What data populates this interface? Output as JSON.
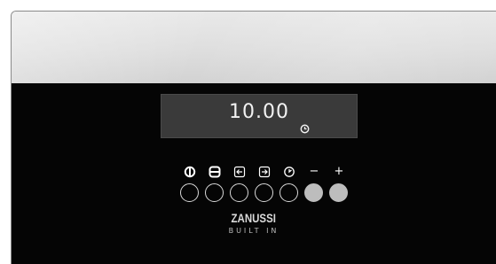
{
  "display": {
    "time": "10.00",
    "indicator_icon": "clock-icon"
  },
  "controls": [
    {
      "icon": "power-icon",
      "label": ""
    },
    {
      "icon": "function-menu-icon",
      "label": ""
    },
    {
      "icon": "arrow-left-box-icon",
      "label": ""
    },
    {
      "icon": "arrow-right-box-icon",
      "label": ""
    },
    {
      "icon": "timer-icon",
      "label": ""
    },
    {
      "icon": "minus-icon",
      "label": "−"
    },
    {
      "icon": "plus-icon",
      "label": "+"
    }
  ],
  "brand": {
    "name": "ZANUSSI",
    "subtitle": "BUILT IN"
  },
  "colors": {
    "panel": "#050505",
    "display_bg": "#3a3a3a",
    "button_ring": "#d8d8d8",
    "button_fill": "#bdbdbd",
    "glass": "#dedede"
  }
}
